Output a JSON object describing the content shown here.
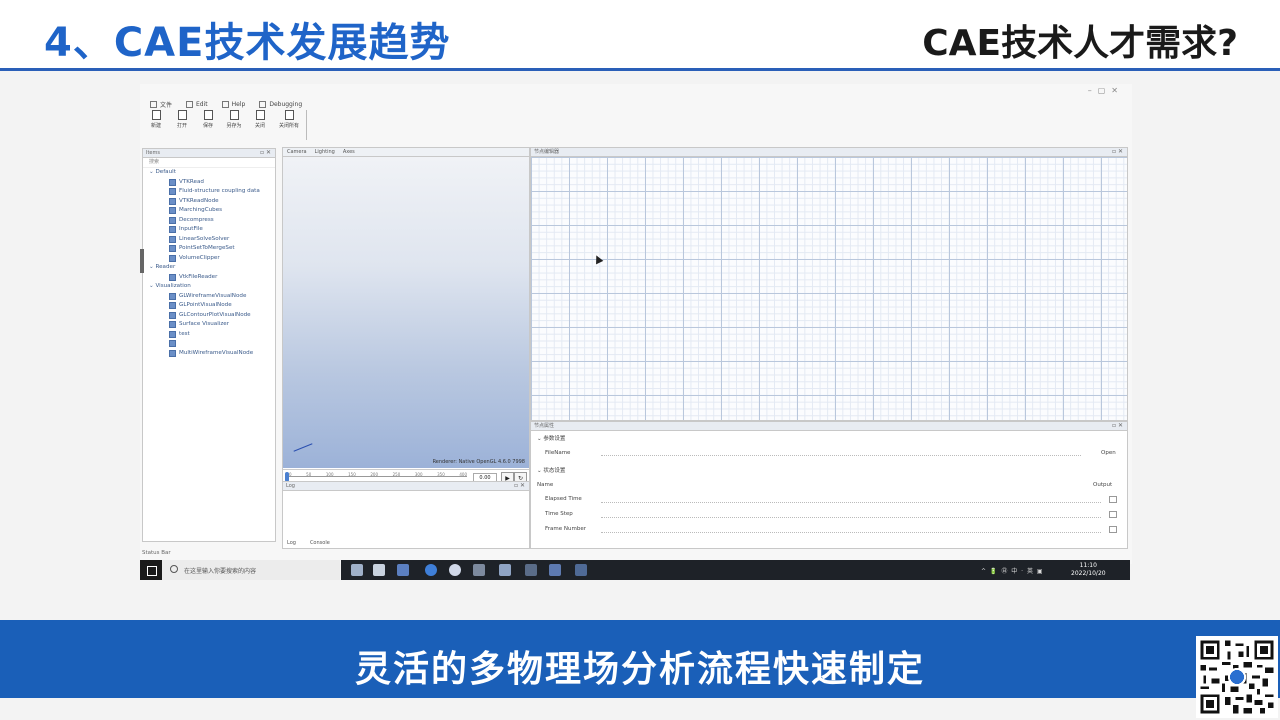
{
  "slide": {
    "title": "4、CAE技术发展趋势",
    "subtitle": "CAE技术人才需求?",
    "caption": "灵活的多物理场分析流程快速制定",
    "accent_color": "#1f64c8",
    "caption_bg": "#1a5fb8"
  },
  "app": {
    "window_title": "",
    "menu": [
      {
        "icon": "file-icon",
        "label": "文件"
      },
      {
        "icon": "edit-icon",
        "label": "Edit"
      },
      {
        "icon": "help-icon",
        "label": "Help"
      },
      {
        "icon": "debug-icon",
        "label": "Debugging"
      }
    ],
    "ribbon": [
      {
        "icon": "new-icon",
        "label": "新建"
      },
      {
        "icon": "open-icon",
        "label": "打开"
      },
      {
        "icon": "save-icon",
        "label": "保存"
      },
      {
        "icon": "saveas-icon",
        "label": "另存为"
      },
      {
        "icon": "close-icon",
        "label": "关闭"
      },
      {
        "icon": "ribbon-extra-icon",
        "label": "关闭所有"
      }
    ],
    "left_panel": {
      "header": "Items",
      "search_placeholder": "搜索",
      "groups": [
        {
          "label": "Default",
          "items": [
            "VTKRead",
            "Fluid-structure coupling data",
            "VTKReadNode",
            "MarchingCubes",
            "Decompress",
            "InputFile",
            "LinearSolveSolver",
            "PointSetToMergeSet",
            "VolumeClipper"
          ]
        },
        {
          "label": "Reader",
          "items": [
            "VtkFileReader"
          ]
        },
        {
          "label": "Visualization",
          "items": [
            "GLWireframeVisualNode",
            "GLPointVisualNode",
            "GLContourPlotVisualNode",
            "Surface Visualizer",
            "test",
            "",
            "MultiWireframeVisualNode"
          ]
        }
      ]
    },
    "viewport": {
      "tabs": [
        "Camera",
        "Lighting",
        "Axes"
      ],
      "info": "Renderer: Native OpenGL 4.6.0 7998",
      "timeline_ticks": [
        "0",
        "50",
        "100",
        "150",
        "200",
        "250",
        "300",
        "350",
        "400"
      ],
      "time_value": "0.00"
    },
    "log_panel": {
      "header": "Log",
      "tabs": [
        "Log",
        "Console"
      ]
    },
    "canvas": {
      "header": "节点编辑器"
    },
    "properties": {
      "header": "节点属性",
      "section1": "参数设置",
      "field_label": "FileName",
      "field_button": "Open",
      "section2": "状态设置",
      "col_left": "Name",
      "col_right": "Output",
      "rows": [
        "Elapsed Time",
        "Time Step",
        "Frame Number"
      ]
    },
    "status_bar": "Status Bar"
  },
  "taskbar": {
    "search_text": "在这里输入你要搜索的内容",
    "tray": "^ 🔋 ㊐ 中 · 英 ▣",
    "time": "11:10",
    "date": "2022/10/20"
  }
}
